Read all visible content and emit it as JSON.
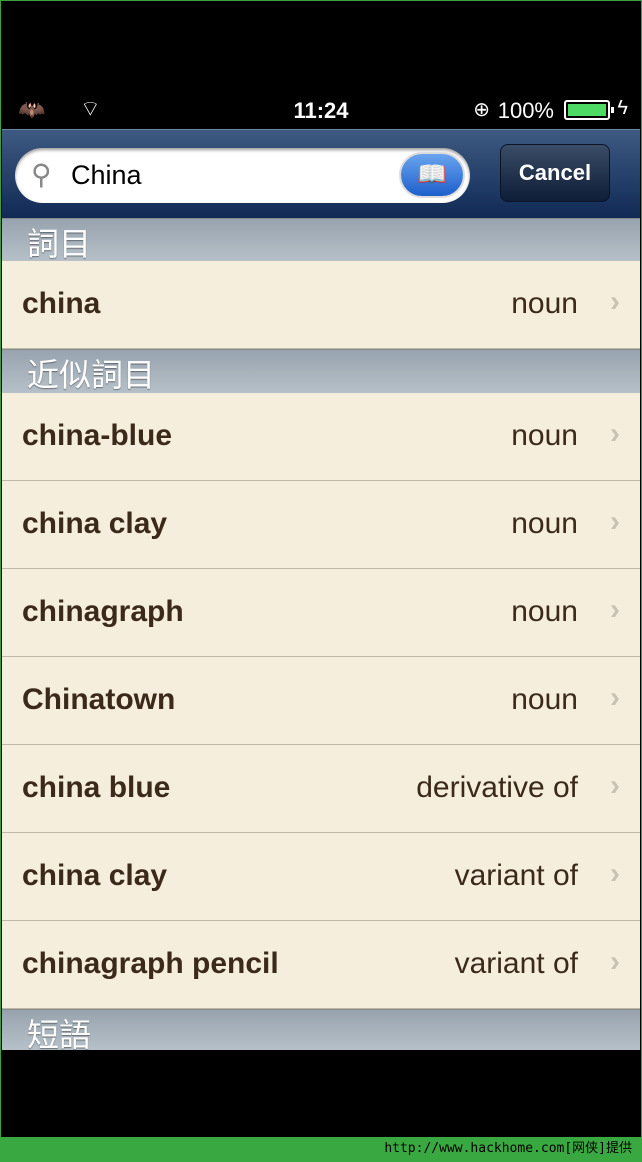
{
  "status": {
    "time": "11:24",
    "battery_percent": "100%",
    "battery_level": 1.0,
    "carrier_icon": "batman-logo-icon",
    "wifi_icon": "wifi-icon",
    "lock_icon": "rotation-lock-icon",
    "charging_icon": "bolt-icon"
  },
  "search": {
    "value": "China",
    "placeholder": "",
    "cancel_label": "Cancel",
    "book_icon": "book-icon"
  },
  "sections": [
    {
      "title": "詞目",
      "rows": [
        {
          "word": "china",
          "type": "noun"
        }
      ]
    },
    {
      "title": "近似詞目",
      "rows": [
        {
          "word": "china-blue",
          "type": "noun"
        },
        {
          "word": "china clay",
          "type": "noun"
        },
        {
          "word": "chinagraph",
          "type": "noun"
        },
        {
          "word": "Chinatown",
          "type": "noun"
        },
        {
          "word": "china blue",
          "type": "derivative of"
        },
        {
          "word": "china clay",
          "type": "variant of"
        },
        {
          "word": "chinagraph pencil",
          "type": "variant of"
        }
      ]
    },
    {
      "title": "短語",
      "rows": []
    }
  ],
  "watermark": "http://www.hackhome.com[网侠]提供"
}
